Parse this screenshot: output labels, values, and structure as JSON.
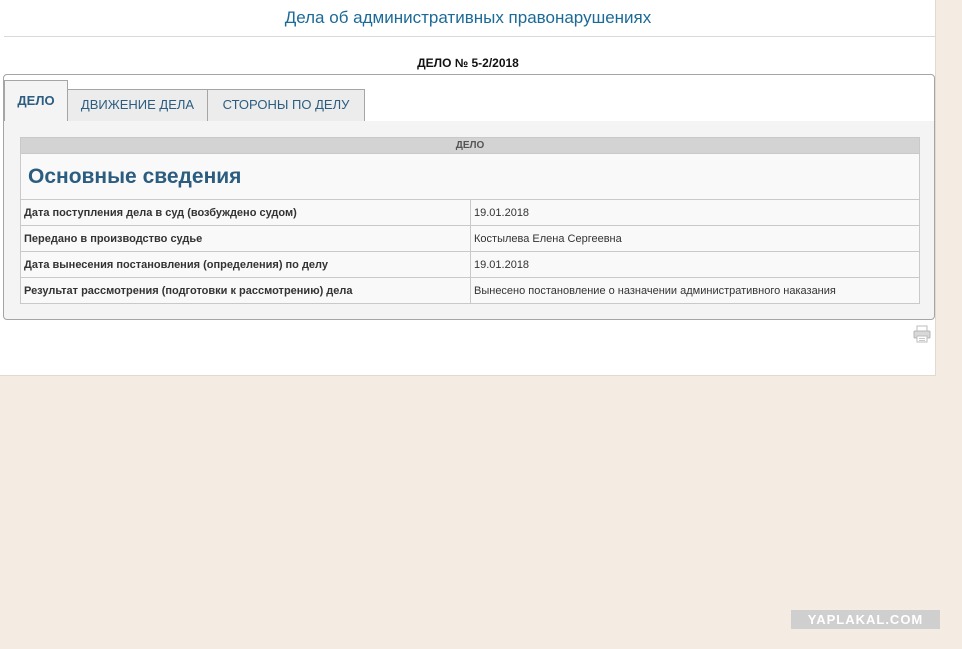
{
  "header": {
    "section_title": "Дела об административных правонарушениях",
    "case_number": "ДЕЛО № 5-2/2018"
  },
  "tabs": [
    {
      "label": "ДЕЛО",
      "active": true
    },
    {
      "label": "ДВИЖЕНИЕ ДЕЛА",
      "active": false
    },
    {
      "label": "СТОРОНЫ ПО ДЕЛУ",
      "active": false
    }
  ],
  "table": {
    "header": "ДЕЛО",
    "heading": "Основные сведения",
    "rows": [
      {
        "label": "Дата поступления дела в суд (возбуждено судом)",
        "value": "19.01.2018"
      },
      {
        "label": "Передано в производство судье",
        "value": "Костылева Елена Сергеевна"
      },
      {
        "label": "Дата вынесения постановления (определения) по делу",
        "value": "19.01.2018"
      },
      {
        "label": "Результат рассмотрения (подготовки к рассмотрению) дела",
        "value": "Вынесено постановление о назначении административного наказания"
      }
    ]
  },
  "print": {
    "icon": "printer-icon"
  },
  "watermark": "YAPLAKAL.COM",
  "colors": {
    "accent": "#2c5d80",
    "title": "#1c6a97",
    "background": "#f4ece3"
  }
}
